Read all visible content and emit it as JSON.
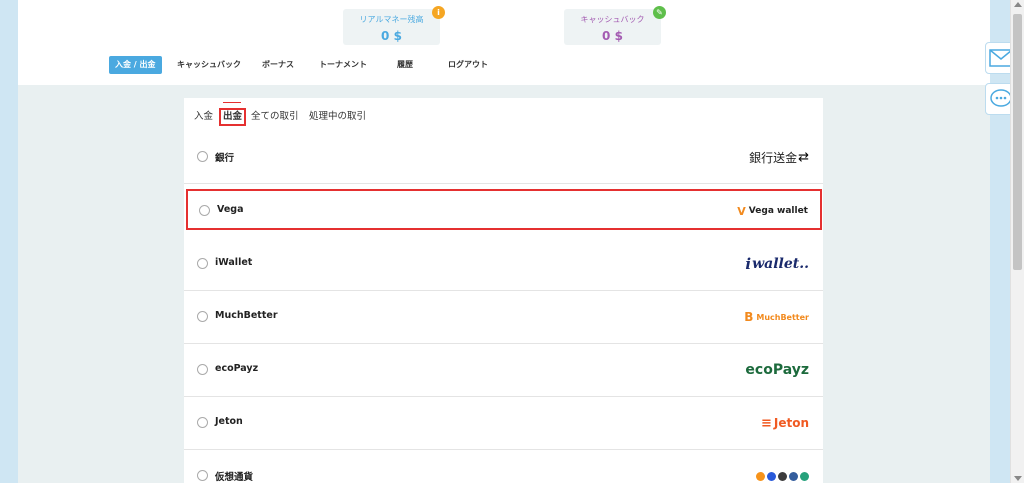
{
  "balances": {
    "real_money": {
      "label": "リアルマネー残高",
      "value": "0 $",
      "icon": "info-icon"
    },
    "cashback": {
      "label": "キャッシュバック",
      "value": "0 $",
      "icon": "edit-icon"
    }
  },
  "nav": {
    "items": [
      "入金 / 出金",
      "キャッシュバック",
      "ボーナス",
      "トーナメント",
      "履歴",
      "ログアウト"
    ],
    "active_index": 0
  },
  "tabs": {
    "items": [
      "入金",
      "出金",
      "全ての取引",
      "処理中の取引"
    ],
    "selected_index": 1
  },
  "methods": [
    {
      "name": "銀行",
      "logo_text": "銀行送金"
    },
    {
      "name": "Vega",
      "logo_text": "Vega wallet"
    },
    {
      "name": "iWallet",
      "logo_text": "wallet.."
    },
    {
      "name": "MuchBetter",
      "logo_text": "MuchBetter"
    },
    {
      "name": "ecoPayz",
      "logo_text": "ecoPayz"
    },
    {
      "name": "Jeton",
      "logo_text": "Jeton"
    },
    {
      "name": "仮想通貨",
      "logo_text": ""
    }
  ],
  "colors": {
    "accent": "#4aa9e0",
    "highlight": "#e53030",
    "cashback": "#a35bb1"
  },
  "side_buttons": [
    "mail-icon",
    "chat-icon"
  ]
}
